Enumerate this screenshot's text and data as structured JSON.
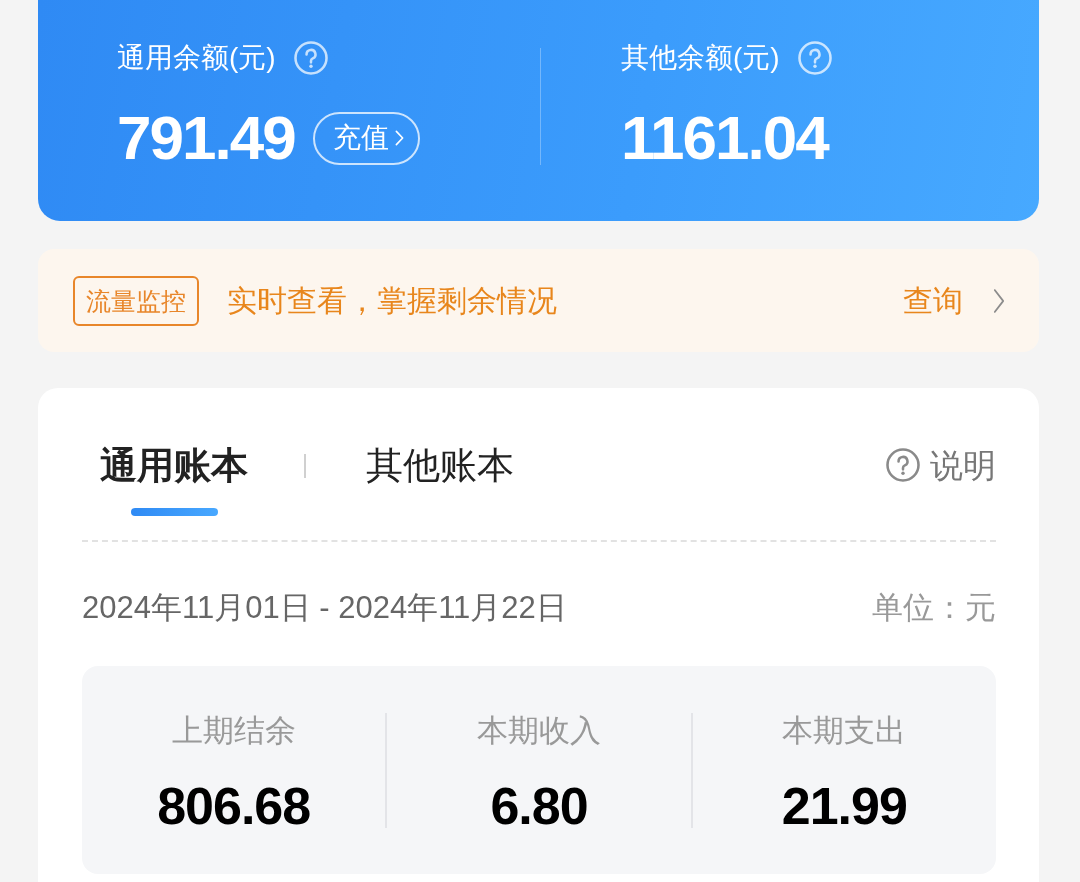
{
  "balances": [
    {
      "label": "通用余额(元)",
      "amount": "791.49",
      "action": "充值"
    },
    {
      "label": "其他余额(元)",
      "amount": "1161.04"
    }
  ],
  "banner": {
    "tag": "流量监控",
    "message": "实时查看，掌握剩余情况",
    "action": "查询"
  },
  "ledger": {
    "tabs": [
      {
        "label": "通用账本",
        "selected": true
      },
      {
        "label": "其他账本",
        "selected": false
      }
    ],
    "help": "说明",
    "period": "2024年11月01日 - 2024年11月22日",
    "unit": "单位：元",
    "stats": [
      {
        "label": "上期结余",
        "value": "806.68"
      },
      {
        "label": "本期收入",
        "value": "6.80"
      },
      {
        "label": "本期支出",
        "value": "21.99"
      }
    ]
  }
}
